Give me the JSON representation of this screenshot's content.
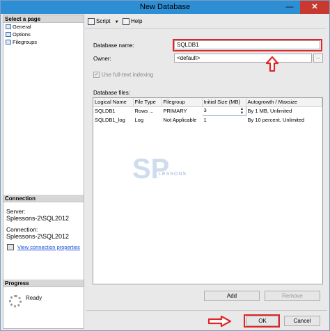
{
  "window": {
    "title": "New Database",
    "minimize": "—",
    "close": "✕"
  },
  "left_panel": {
    "select_page_header": "Select a page",
    "pages": [
      {
        "label": "General",
        "icon": "page-icon"
      },
      {
        "label": "Options",
        "icon": "page-icon"
      },
      {
        "label": "Filegroups",
        "icon": "page-icon"
      }
    ],
    "connection_header": "Connection",
    "server_label": "Server:",
    "server_value": "Splessons-2\\SQL2012",
    "connection_label": "Connection:",
    "connection_value": "Splessons-2\\SQL2012",
    "view_link": "View connection properties",
    "progress_header": "Progress",
    "progress_status": "Ready"
  },
  "toolbar": {
    "script_label": "Script",
    "help_label": "Help"
  },
  "form": {
    "db_name_label": "Database name:",
    "db_name_value": "SQLDB1",
    "owner_label": "Owner:",
    "owner_value": "<default>",
    "owner_button": "...",
    "fulltext_label": "Use full-text indexing",
    "files_label": "Database files:"
  },
  "files_table": {
    "headers": [
      "Logical Name",
      "File Type",
      "Filegroup",
      "Initial Size (MB)",
      "Autogrowth / Maxsize"
    ],
    "rows": [
      [
        "SQLDB1",
        "Rows ...",
        "PRIMARY",
        "3",
        "By 1 MB, Unlimited"
      ],
      [
        "SQLDB1_log",
        "Log",
        "Not Applicable",
        "1",
        "By 10 percent, Unlimited"
      ]
    ]
  },
  "watermark": {
    "text": "LESSONS"
  },
  "buttons": {
    "add": "Add",
    "remove": "Remove",
    "ok": "OK",
    "cancel": "Cancel"
  },
  "colors": {
    "highlight": "#e0262a",
    "titlebar": "#2e8ed4",
    "link": "#1a4ed8"
  }
}
